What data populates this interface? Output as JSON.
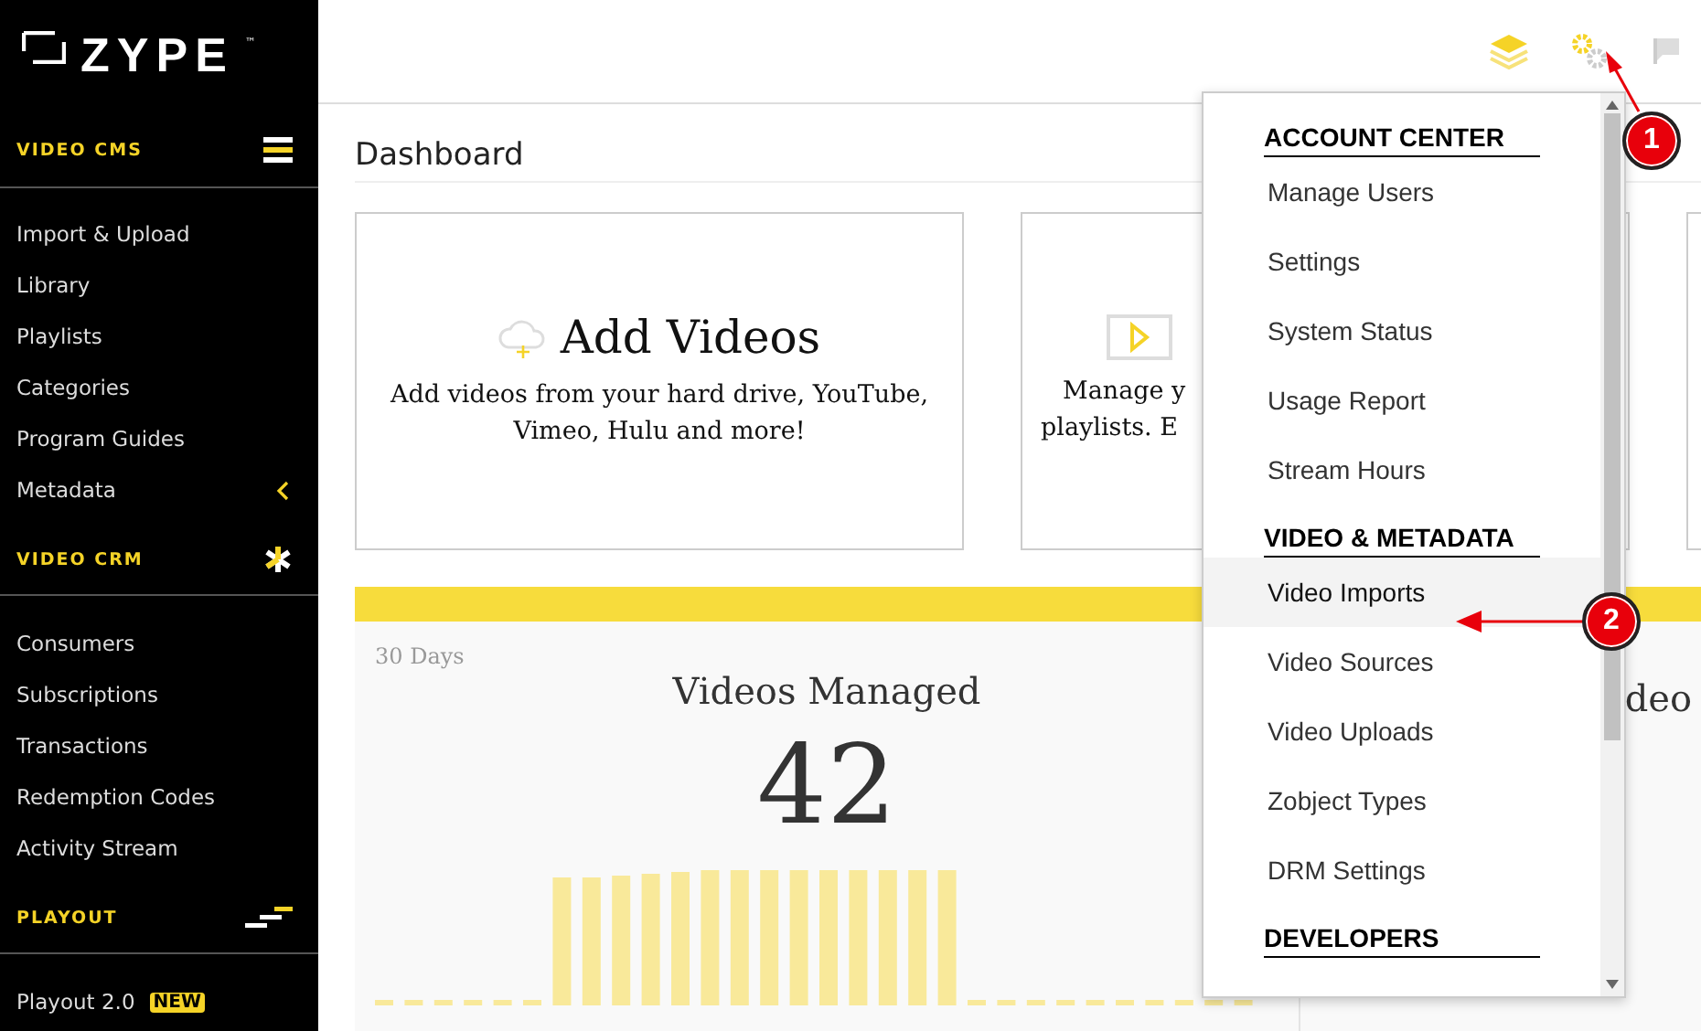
{
  "sidebar": {
    "logo": "ZYPE",
    "trademark": "™",
    "sections": [
      {
        "title": "VIDEO CMS",
        "kind": "cms",
        "items": [
          {
            "label": "Import & Upload",
            "kind": "link"
          },
          {
            "label": "Library",
            "kind": "link"
          },
          {
            "label": "Playlists",
            "kind": "link"
          },
          {
            "label": "Categories",
            "kind": "link"
          },
          {
            "label": "Program Guides",
            "kind": "link"
          },
          {
            "label": "Metadata",
            "kind": "submenu"
          }
        ]
      },
      {
        "title": "VIDEO CRM",
        "kind": "crm",
        "items": [
          {
            "label": "Consumers",
            "kind": "link"
          },
          {
            "label": "Subscriptions",
            "kind": "link"
          },
          {
            "label": "Transactions",
            "kind": "link"
          },
          {
            "label": "Redemption Codes",
            "kind": "link"
          },
          {
            "label": "Activity Stream",
            "kind": "link"
          }
        ]
      },
      {
        "title": "PLAYOUT",
        "kind": "playout",
        "items": [
          {
            "label": "Playout 2.0",
            "kind": "link",
            "badge": "NEW"
          }
        ]
      }
    ]
  },
  "page": {
    "title": "Dashboard",
    "cards": [
      {
        "kind": "upload",
        "title": "Add Videos",
        "text": "Add videos from your hard drive, YouTube, Vimeo, Hulu and more!"
      },
      {
        "kind": "playlist",
        "lines": [
          "Manage y",
          "playlists. E"
        ]
      },
      {
        "kind": "blank"
      }
    ],
    "stats": [
      {
        "period": "30 Days",
        "title": "Videos Managed",
        "value": "42"
      },
      {
        "title": "deo"
      }
    ]
  },
  "settings_menu": {
    "sections": [
      {
        "title": "ACCOUNT CENTER",
        "items": [
          {
            "label": "Manage Users",
            "selected": false
          },
          {
            "label": "Settings",
            "selected": false
          },
          {
            "label": "System Status",
            "selected": false
          },
          {
            "label": "Usage Report",
            "selected": false
          },
          {
            "label": "Stream Hours",
            "selected": false
          }
        ]
      },
      {
        "title": "VIDEO & METADATA",
        "items": [
          {
            "label": "Video Imports",
            "selected": true
          },
          {
            "label": "Video Sources",
            "selected": false
          },
          {
            "label": "Video Uploads",
            "selected": false
          },
          {
            "label": "Zobject Types",
            "selected": false
          },
          {
            "label": "DRM Settings",
            "selected": false
          }
        ]
      },
      {
        "title": "DEVELOPERS"
      }
    ]
  },
  "annotations": [
    {
      "number": "1"
    },
    {
      "number": "2"
    }
  ]
}
